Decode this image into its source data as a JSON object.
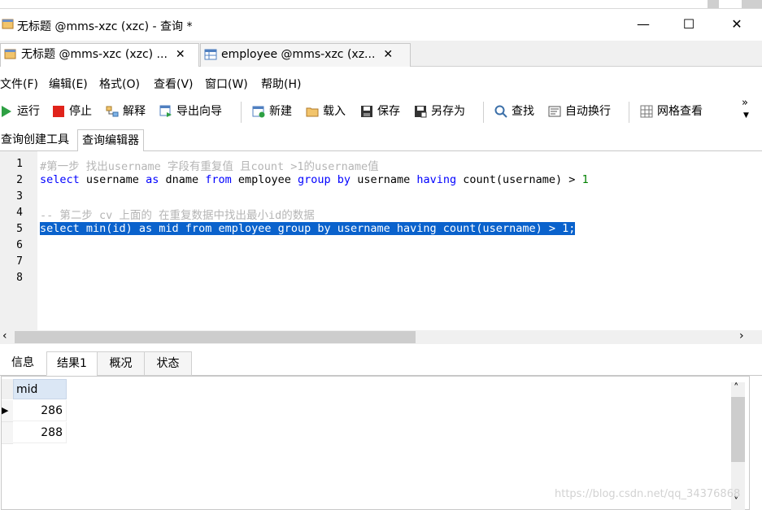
{
  "window": {
    "title": "无标题 @mms-xzc (xzc) - 查询 *",
    "controls": {
      "minimize": "—",
      "maximize": "☐",
      "close": "✕"
    }
  },
  "doc_tabs": [
    {
      "label": "无标题 @mms-xzc (xzc) ...",
      "close": "✕",
      "icon": "query-icon",
      "active": true
    },
    {
      "label": "employee @mms-xzc (xz...",
      "close": "✕",
      "icon": "table-icon",
      "active": false
    }
  ],
  "menu": [
    "文件(F)",
    "编辑(E)",
    "格式(O)",
    "查看(V)",
    "窗口(W)",
    "帮助(H)"
  ],
  "toolbar": {
    "run": "运行",
    "stop": "停止",
    "explain": "解释",
    "export": "导出向导",
    "new": "新建",
    "load": "载入",
    "save": "保存",
    "save_as": "另存为",
    "find": "查找",
    "wrap": "自动换行",
    "grid": "网格查看",
    "overflow": "»"
  },
  "editor_tabs": [
    "查询创建工具",
    "查询编辑器"
  ],
  "editor": {
    "line_numbers": [
      "1",
      "2",
      "3",
      "4",
      "5",
      "6",
      "7",
      "8"
    ],
    "line1": "#第一步 找出username 字段有重复值 且count >1的username值",
    "line2": {
      "kw1": "select",
      "t1": " username ",
      "kw2": "as",
      "t2": " dname ",
      "kw3": "from",
      "t3": " employee ",
      "kw4": "group by",
      "t4": " username ",
      "kw5": "having",
      "t5": " count(username) > ",
      "num": "1"
    },
    "line4": "-- 第二步 cv 上面的 在重复数据中找出最小id的数据",
    "line5": "select min(id) as mid from employee group by username having count(username) > 1;"
  },
  "scroll": {
    "left": "‹",
    "right": "›",
    "up": "˄",
    "down": "˅"
  },
  "result_tabs": [
    "信息",
    "结果1",
    "概况",
    "状态"
  ],
  "grid": {
    "column": "mid",
    "rows": [
      "286",
      "288"
    ],
    "current_row_marker": "▶"
  },
  "watermark": "https://blog.csdn.net/qq_34376868",
  "colors": {
    "selection": "#0a62cc",
    "keyword": "#0000ff",
    "comment": "#b5b5b5",
    "number": "#008000"
  }
}
